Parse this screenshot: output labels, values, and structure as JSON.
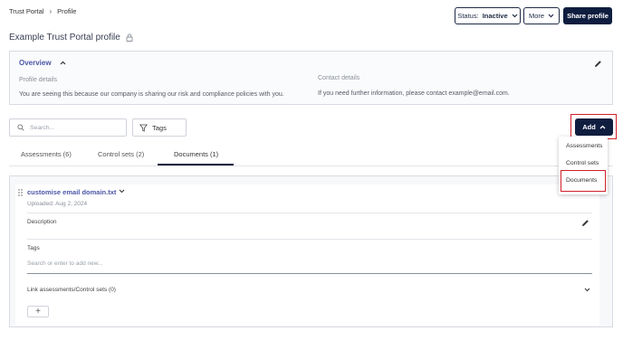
{
  "breadcrumb": {
    "root": "Trust Portal",
    "current": "Profile"
  },
  "header": {
    "status_label": "Status:",
    "status_value": "Inactive",
    "more_label": "More",
    "share_label": "Share profile"
  },
  "page": {
    "title": "Example Trust Portal profile"
  },
  "overview": {
    "heading": "Overview",
    "profile_details_label": "Profile details",
    "profile_details_text": "You are seeing this because our company is sharing our risk and compliance policies with you.",
    "contact_details_label": "Contact details",
    "contact_details_text": "If you need further information, please contact example@email.com."
  },
  "toolbar": {
    "search_placeholder": "Search...",
    "tags_label": "Tags",
    "add_label": "Add"
  },
  "tabs": [
    {
      "label": "Assessments (6)"
    },
    {
      "label": "Control sets (2)"
    },
    {
      "label": "Documents (1)"
    }
  ],
  "add_menu": {
    "items": [
      {
        "label": "Assessments"
      },
      {
        "label": "Control sets"
      },
      {
        "label": "Documents"
      }
    ]
  },
  "document": {
    "name": "customise email domain.txt",
    "uploaded": "Uploaded: Aug 2, 2024",
    "description_label": "Description",
    "tags_label": "Tags",
    "tags_placeholder": "Search or enter to add new...",
    "link_label": "Link assessments/Control sets (0)",
    "add_link_label": "+"
  },
  "colors": {
    "primary": "#0f1d3f",
    "link": "#4b56a8",
    "highlight": "#d1202a"
  }
}
